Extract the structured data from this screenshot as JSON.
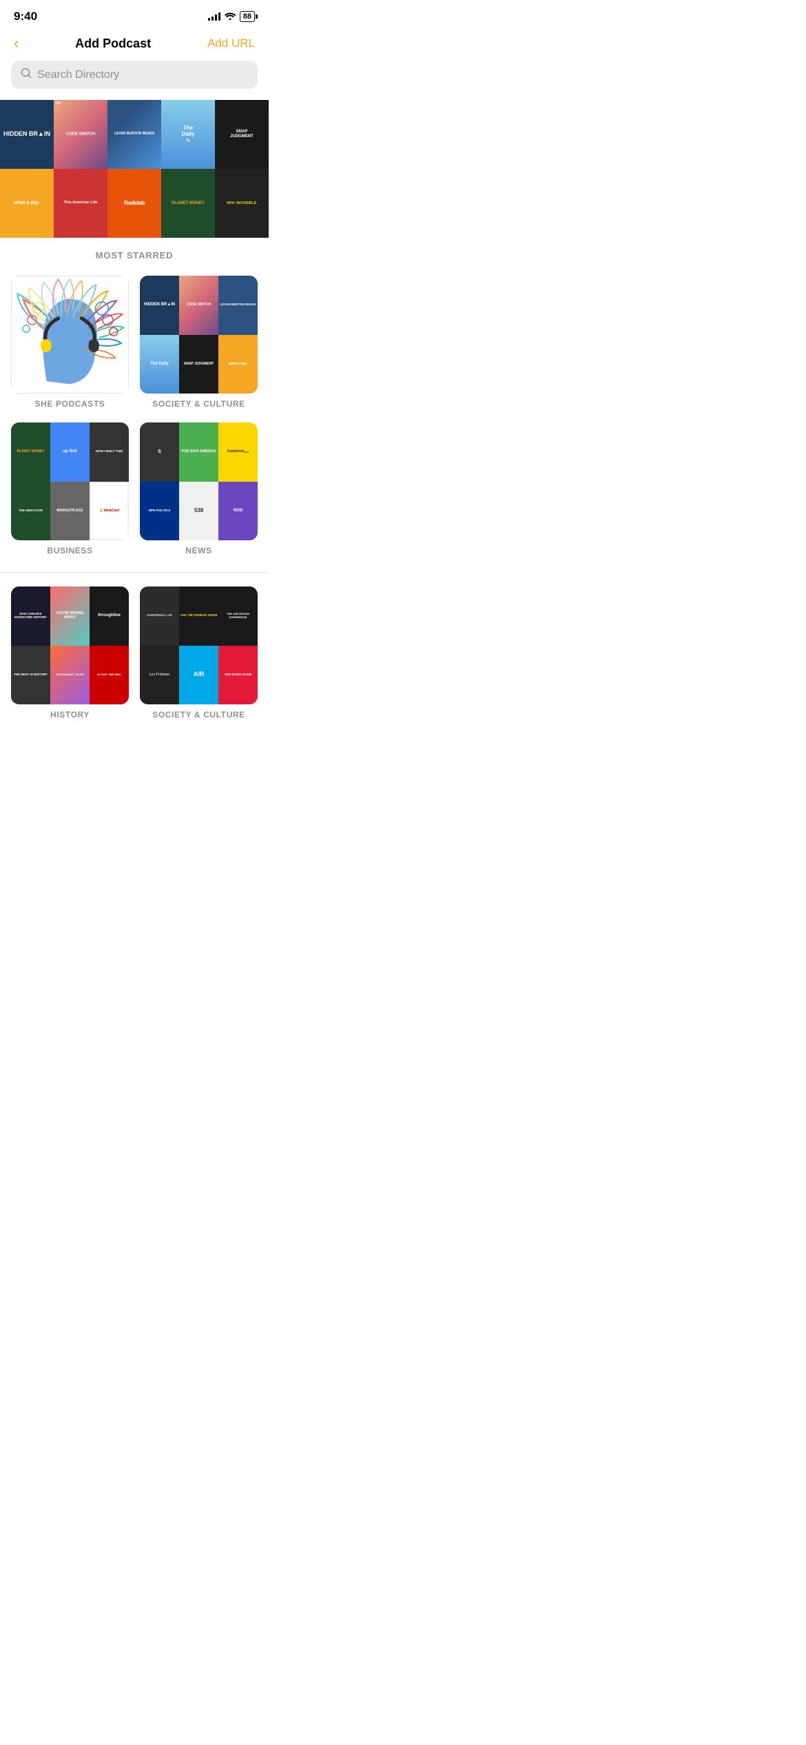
{
  "statusBar": {
    "time": "9:40",
    "battery": "88"
  },
  "navBar": {
    "backLabel": "‹",
    "title": "Add Podcast",
    "addUrlLabel": "Add URL"
  },
  "search": {
    "placeholder": "Search Directory"
  },
  "sections": {
    "mostStarred": "MOST STARRED",
    "categories": [
      {
        "id": "she-podcasts",
        "name": "SHE PODCASTS"
      },
      {
        "id": "society-culture",
        "name": "SOCIETY & CULTURE"
      },
      {
        "id": "business",
        "name": "BUSINESS"
      },
      {
        "id": "news",
        "name": "NEWS"
      },
      {
        "id": "history",
        "name": "HISTORY"
      },
      {
        "id": "society2",
        "name": "SOCIETY & CULTURE"
      }
    ]
  },
  "podcasts": {
    "featured": [
      {
        "id": "hidden-brain",
        "title": "HIDDEN BRAIN"
      },
      {
        "id": "code-switch",
        "title": "CODE SWITCH"
      },
      {
        "id": "levar-burton",
        "title": "LEVAR BURTON READS"
      },
      {
        "id": "the-daily",
        "title": "The Daily"
      },
      {
        "id": "snap-judgment",
        "title": "SNAP JUDGMENT"
      },
      {
        "id": "what-a-day",
        "title": "what a day."
      },
      {
        "id": "this-american-life",
        "title": "This American Life"
      },
      {
        "id": "radiolab",
        "title": "Radiolab"
      },
      {
        "id": "planet-money",
        "title": "PLANET MONEY"
      },
      {
        "id": "invisible",
        "title": "99% INVISIBLE"
      }
    ]
  }
}
